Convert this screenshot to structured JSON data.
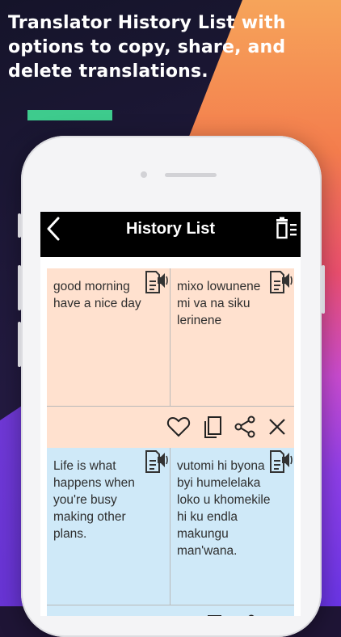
{
  "headline": "Translator History List with options to copy, share, and delete translations.",
  "colors": {
    "accent_bar": "#3ecb8d",
    "card_source": "#ffe1cf",
    "card_alt": "#cfe9f8",
    "appbar": "#000000"
  },
  "appbar": {
    "title": "History List",
    "back_icon": "back-arrow-icon",
    "delete_all_icon": "delete-all-icon"
  },
  "history": [
    {
      "source_text": "good morning have a nice day",
      "translated_text": "mixo lowunene mi va na siku lerinene"
    },
    {
      "source_text": "Life is what happens when you're busy making other plans.",
      "translated_text": "vutomi hi byona byi humelelaka loko u khomekile hi ku endla makungu man'wana."
    }
  ],
  "actions": [
    "favorite-icon",
    "copy-icon",
    "share-icon",
    "delete-icon"
  ]
}
